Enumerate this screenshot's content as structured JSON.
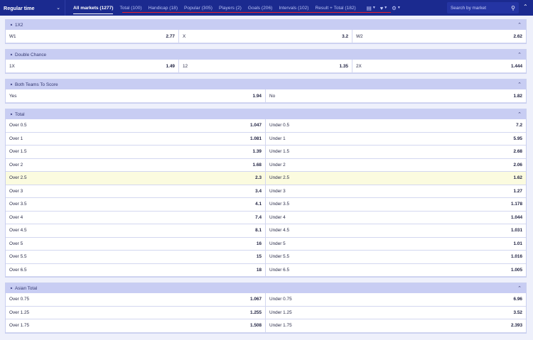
{
  "header": {
    "period": "Regular time",
    "tabs": [
      {
        "label": "All markets (1277)",
        "active": true
      },
      {
        "label": "Total (100)"
      },
      {
        "label": "Handicap (18)"
      },
      {
        "label": "Popular (305)"
      },
      {
        "label": "Players (2)"
      },
      {
        "label": "Goals (206)"
      },
      {
        "label": "Intervals (102)"
      },
      {
        "label": "Result + Total (182)"
      }
    ],
    "search_placeholder": "Search by market",
    "underline_color": "#e8202a"
  },
  "markets": [
    {
      "title": "1X2",
      "cols": 3,
      "rows": [
        [
          [
            "W1",
            "2.77"
          ],
          [
            "X",
            "3.2"
          ],
          [
            "W2",
            "2.62"
          ]
        ]
      ]
    },
    {
      "title": "Double Chance",
      "cols": 3,
      "rows": [
        [
          [
            "1X",
            "1.49"
          ],
          [
            "12",
            "1.35"
          ],
          [
            "2X",
            "1.444"
          ]
        ]
      ]
    },
    {
      "title": "Both Teams To Score",
      "cols": 2,
      "rows": [
        [
          [
            "Yes",
            "1.94"
          ],
          [
            "No",
            "1.82"
          ]
        ]
      ]
    },
    {
      "title": "Total",
      "cols": 2,
      "highlight_row": 4,
      "rows": [
        [
          [
            "Over 0.5",
            "1.047"
          ],
          [
            "Under 0.5",
            "7.2"
          ]
        ],
        [
          [
            "Over 1",
            "1.081"
          ],
          [
            "Under 1",
            "5.95"
          ]
        ],
        [
          [
            "Over 1.5",
            "1.39"
          ],
          [
            "Under 1.5",
            "2.68"
          ]
        ],
        [
          [
            "Over 2",
            "1.68"
          ],
          [
            "Under 2",
            "2.06"
          ]
        ],
        [
          [
            "Over 2.5",
            "2.3"
          ],
          [
            "Under 2.5",
            "1.62"
          ]
        ],
        [
          [
            "Over 3",
            "3.4"
          ],
          [
            "Under 3",
            "1.27"
          ]
        ],
        [
          [
            "Over 3.5",
            "4.1"
          ],
          [
            "Under 3.5",
            "1.178"
          ]
        ],
        [
          [
            "Over 4",
            "7.4"
          ],
          [
            "Under 4",
            "1.044"
          ]
        ],
        [
          [
            "Over 4.5",
            "8.1"
          ],
          [
            "Under 4.5",
            "1.031"
          ]
        ],
        [
          [
            "Over 5",
            "16"
          ],
          [
            "Under 5",
            "1.01"
          ]
        ],
        [
          [
            "Over 5.5",
            "15"
          ],
          [
            "Under 5.5",
            "1.016"
          ]
        ],
        [
          [
            "Over 6.5",
            "18"
          ],
          [
            "Under 6.5",
            "1.005"
          ]
        ]
      ]
    },
    {
      "title": "Asian Total",
      "cols": 2,
      "rows": [
        [
          [
            "Over 0.75",
            "1.067"
          ],
          [
            "Under 0.75",
            "6.96"
          ]
        ],
        [
          [
            "Over 1.25",
            "1.255"
          ],
          [
            "Under 1.25",
            "3.52"
          ]
        ],
        [
          [
            "Over 1.75",
            "1.508"
          ],
          [
            "Under 1.75",
            "2.393"
          ]
        ]
      ]
    }
  ]
}
